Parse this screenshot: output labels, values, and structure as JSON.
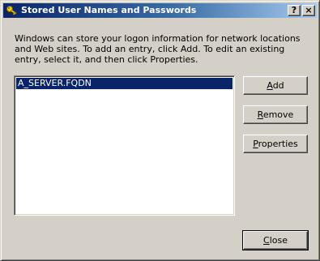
{
  "window": {
    "title": "Stored User Names and Passwords",
    "help_glyph": "?",
    "close_glyph": "×",
    "icon": "key-icon"
  },
  "description": "Windows can store your logon information for network locations and Web sites. To add an entry, click Add. To edit an existing entry, select it, and then click Properties.",
  "list": {
    "items": [
      {
        "label": "A_SERVER.FQDN",
        "selected": true
      }
    ]
  },
  "buttons": {
    "add": {
      "accel": "A",
      "rest": "dd"
    },
    "remove": {
      "accel": "R",
      "rest": "emove"
    },
    "properties": {
      "accel": "P",
      "rest": "roperties"
    },
    "close": {
      "accel": "C",
      "rest": "lose"
    }
  },
  "colors": {
    "title_gradient_start": "#0a246a",
    "title_gradient_end": "#a6caf0",
    "selection": "#0a246a",
    "face": "#d4d0c8"
  }
}
